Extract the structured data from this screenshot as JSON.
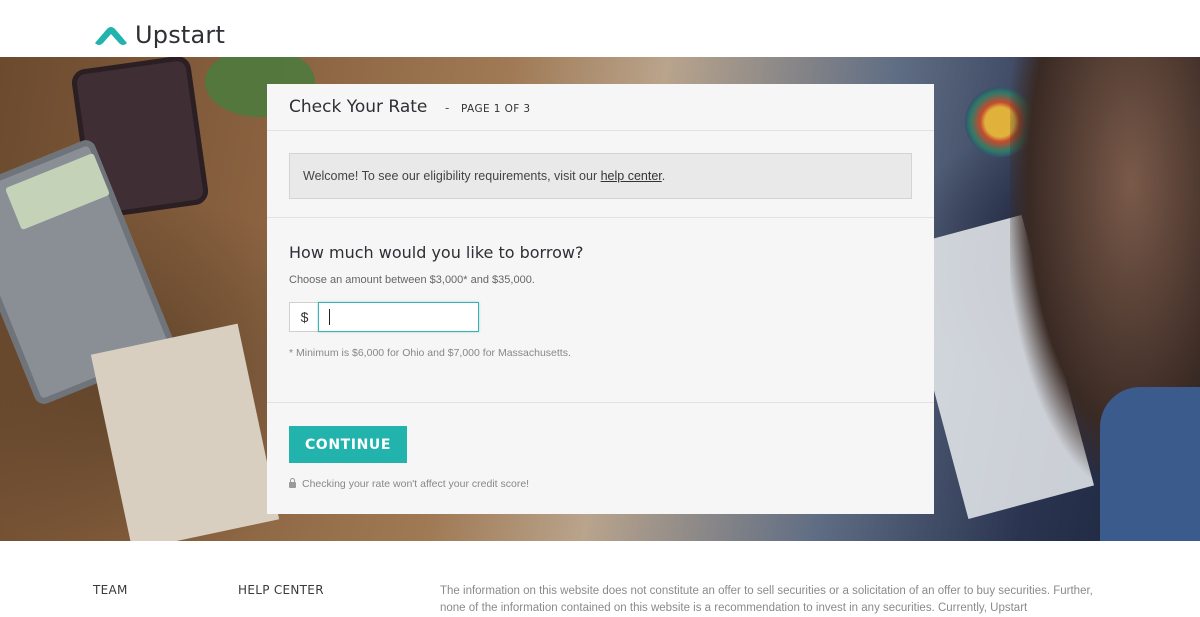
{
  "header": {
    "logo_text": "Upstart",
    "logo_color": "#23b3ad"
  },
  "form": {
    "title": "Check Your Rate",
    "separator": "-",
    "page_indicator": "PAGE 1 OF 3",
    "notice_prefix": "Welcome! To see our eligibility requirements, visit our",
    "notice_link": "help center",
    "notice_suffix": ".",
    "question": "How much would you like to borrow?",
    "hint": "Choose an amount between $3,000* and $35,000.",
    "currency_symbol": "$",
    "amount_value": "",
    "footnote": "* Minimum is $6,000 for Ohio and $7,000 for Massachusetts.",
    "continue_label": "CONTINUE",
    "secure_note": "Checking your rate won't affect your credit score!",
    "accent_color": "#23b3ad"
  },
  "footer": {
    "team_label": "TEAM",
    "help_label": "HELP CENTER",
    "disclaimer": "The information on this website does not constitute an offer to sell securities or a solicitation of an offer to buy securities. Further, none of the information contained on this website is a recommendation to invest in any securities. Currently, Upstart"
  }
}
